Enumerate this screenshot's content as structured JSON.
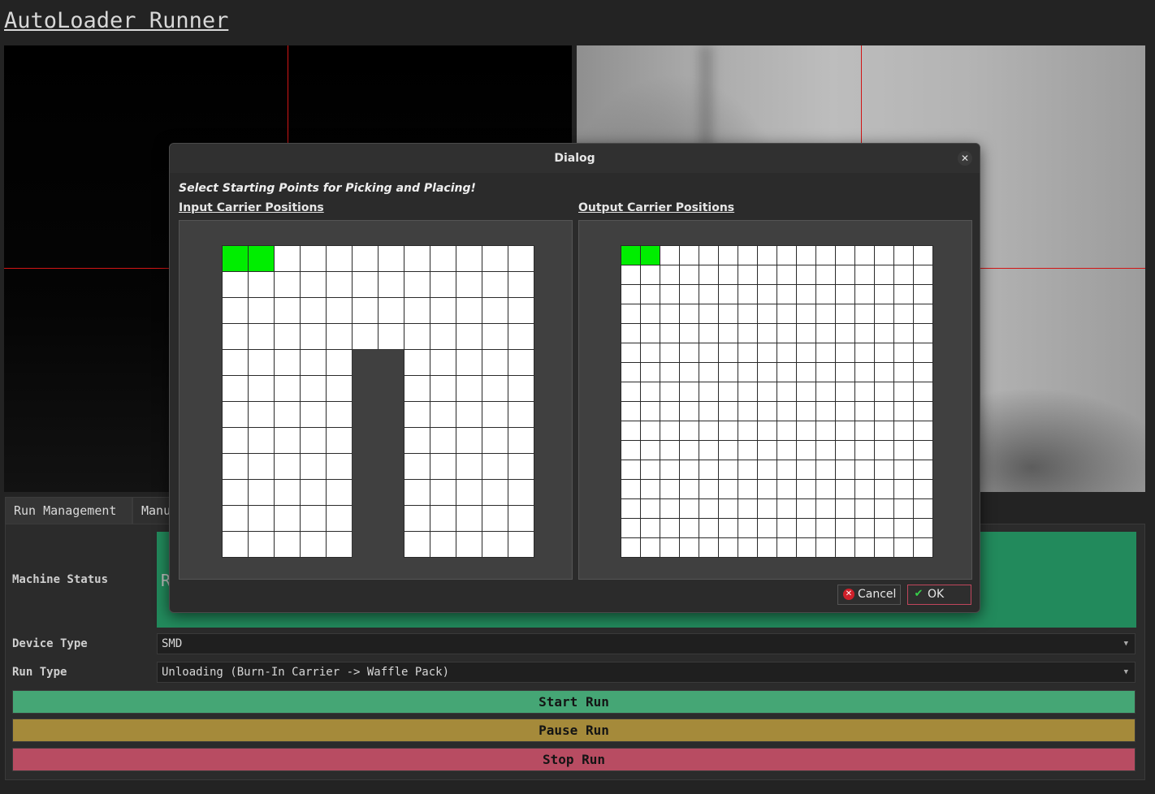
{
  "app": {
    "title": "AutoLoader Runner"
  },
  "tabs": [
    {
      "label": "Run Management"
    },
    {
      "label": "Manu"
    }
  ],
  "run_panel": {
    "machine_status_label": "Machine Status",
    "machine_status_value": "R",
    "status_color": "#228a5c",
    "device_type_label": "Device Type",
    "device_type_value": "SMD",
    "run_type_label": "Run Type",
    "run_type_value": "Unloading (Burn-In Carrier -> Waffle Pack)",
    "start_label": "Start Run",
    "pause_label": "Pause Run",
    "stop_label": "Stop Run"
  },
  "dialog": {
    "title": "Dialog",
    "close_icon": "close-icon",
    "prompt": "Select Starting Points for Picking and Placing!",
    "input_label": "Input Carrier Positions",
    "output_label": "Output Carrier Positions",
    "cancel_label": "Cancel",
    "ok_label": "OK"
  },
  "input_grid": {
    "rows": 12,
    "cols": 12,
    "selected": [
      [
        0,
        0
      ],
      [
        0,
        1
      ]
    ],
    "blocked_cols": [
      5,
      6
    ],
    "blocked_from_row": 4
  },
  "output_grid": {
    "rows": 16,
    "cols": 16,
    "selected": [
      [
        0,
        0
      ],
      [
        0,
        1
      ]
    ]
  },
  "colors": {
    "selected": "#00ee00",
    "cell": "#ffffff",
    "blocked": "#404040",
    "start": "#45a675",
    "pause": "#a58a3a",
    "stop": "#b84c62"
  }
}
